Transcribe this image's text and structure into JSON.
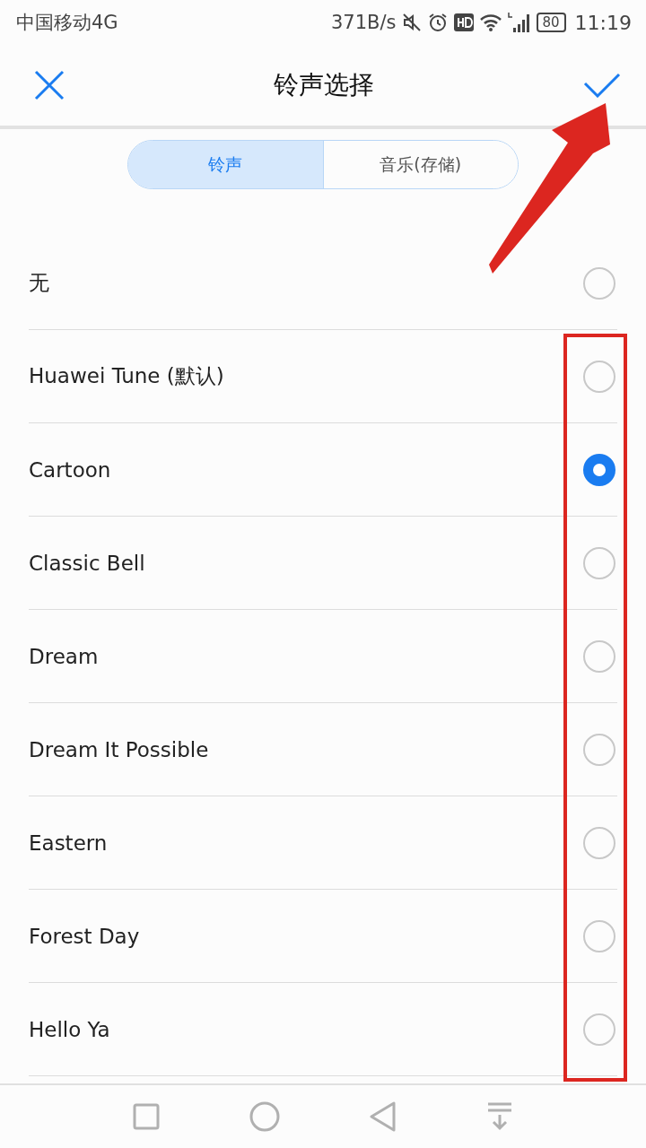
{
  "status_bar": {
    "carrier": "中国移动4G",
    "speed": "371B/s",
    "battery": "80",
    "time": "11:19"
  },
  "header": {
    "title": "铃声选择"
  },
  "tabs": [
    {
      "label": "铃声",
      "selected": true
    },
    {
      "label": "音乐(存储)",
      "selected": false
    }
  ],
  "ringtones": [
    {
      "name": "无",
      "selected": false
    },
    {
      "name": "Huawei Tune (默认)",
      "selected": false
    },
    {
      "name": "Cartoon",
      "selected": true
    },
    {
      "name": "Classic Bell",
      "selected": false
    },
    {
      "name": "Dream",
      "selected": false
    },
    {
      "name": "Dream It Possible",
      "selected": false
    },
    {
      "name": "Eastern",
      "selected": false
    },
    {
      "name": "Forest Day",
      "selected": false
    },
    {
      "name": "Hello Ya",
      "selected": false
    }
  ]
}
